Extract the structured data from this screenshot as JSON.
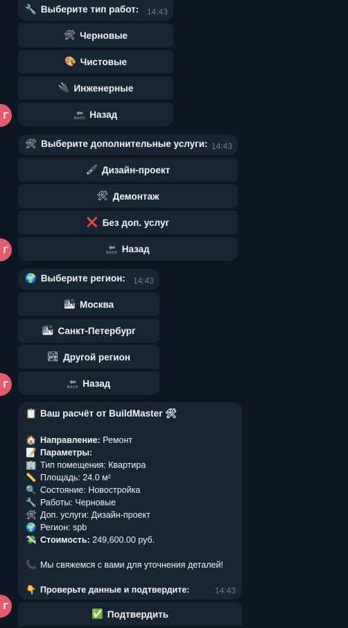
{
  "g1": {
    "prompt_icon": "wrench-icon",
    "prompt": "Выберите тип работ:",
    "time": "14:43",
    "buttons": [
      {
        "icon": "hammer-wrench-icon",
        "emoji": "🛠",
        "label": "Черновые"
      },
      {
        "icon": "palette-icon",
        "emoji": "🎨",
        "label": "Чистовые"
      },
      {
        "icon": "plug-icon",
        "emoji": "🔌",
        "label": "Инженерные"
      },
      {
        "icon": "back-icon",
        "emoji": "⬅",
        "label": "Назад"
      }
    ]
  },
  "g2": {
    "prompt_icon": "hammer-wrench-icon",
    "prompt": "Выберите дополнительные услуги:",
    "time": "14:43",
    "buttons": [
      {
        "icon": "paintbrush-icon",
        "emoji": "🖌",
        "label": "Дизайн-проект"
      },
      {
        "icon": "hammer-wrench-icon",
        "emoji": "🛠",
        "label": "Демонтаж"
      },
      {
        "icon": "cross-mark-icon",
        "emoji": "❌",
        "label": "Без доп. услуг"
      },
      {
        "icon": "back-icon",
        "emoji": "⬅",
        "label": "Назад"
      }
    ]
  },
  "g3": {
    "prompt_icon": "globe-icon",
    "prompt": "Выберите регион:",
    "time": "14:43",
    "buttons": [
      {
        "icon": "cityscape-icon",
        "emoji": "🏙",
        "label": "Москва"
      },
      {
        "icon": "cityscape-icon",
        "emoji": "🏙",
        "label": "Санкт-Петербург"
      },
      {
        "icon": "landscape-icon",
        "emoji": "🏞",
        "label": "Другой регион"
      },
      {
        "icon": "back-icon",
        "emoji": "⬅",
        "label": "Назад"
      }
    ]
  },
  "back_icon_text": "BACK",
  "calc": {
    "title": "Ваш расчёт от BuildMaster",
    "title_icon": "clipboard-icon",
    "title_icon_after": "hammer-wrench-icon",
    "direction_label": "Направление:",
    "direction_value": "Ремонт",
    "params_label": "Параметры:",
    "room_type": "Тип помещения: Квартира",
    "area": "Площадь: 24.0 м²",
    "condition": "Состояние: Новостройка",
    "works": "Работы: Черновые",
    "extra": "Доп. услуги: Дизайн-проект",
    "region": "Регион: spb",
    "cost_label": "Стоимость:",
    "cost_value": "249,600.00 руб.",
    "contact": "Мы свяжемся с вами для уточнения деталей!",
    "check": "Проверьте данные и подтвердите:",
    "time": "14:43",
    "confirm": "Подтвердить"
  },
  "colors": {
    "background": "#0e1621",
    "bubble": "#182533",
    "time": "#6d7f8f",
    "avatar": "#e55a6e"
  }
}
